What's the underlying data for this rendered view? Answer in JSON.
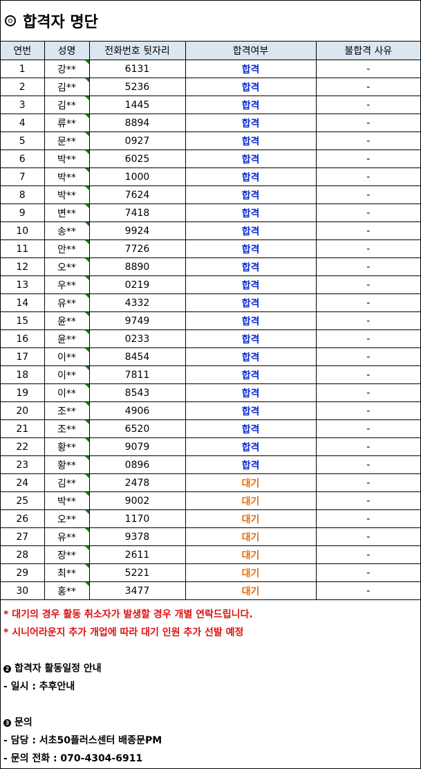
{
  "title": "합격자 명단",
  "columns": [
    "연번",
    "성명",
    "전화번호 뒷자리",
    "합격여부",
    "불합격 사유"
  ],
  "rows": [
    [
      "1",
      "강**",
      "6131",
      "합격",
      "-"
    ],
    [
      "2",
      "김**",
      "5236",
      "합격",
      "-"
    ],
    [
      "3",
      "김**",
      "1445",
      "합격",
      "-"
    ],
    [
      "4",
      "류**",
      "8894",
      "합격",
      "-"
    ],
    [
      "5",
      "문**",
      "0927",
      "합격",
      "-"
    ],
    [
      "6",
      "박**",
      "6025",
      "합격",
      "-"
    ],
    [
      "7",
      "박**",
      "1000",
      "합격",
      "-"
    ],
    [
      "8",
      "박**",
      "7624",
      "합격",
      "-"
    ],
    [
      "9",
      "변**",
      "7418",
      "합격",
      "-"
    ],
    [
      "10",
      "송**",
      "9924",
      "합격",
      "-"
    ],
    [
      "11",
      "안**",
      "7726",
      "합격",
      "-"
    ],
    [
      "12",
      "오**",
      "8890",
      "합격",
      "-"
    ],
    [
      "13",
      "우**",
      "0219",
      "합격",
      "-"
    ],
    [
      "14",
      "유**",
      "4332",
      "합격",
      "-"
    ],
    [
      "15",
      "윤**",
      "9749",
      "합격",
      "-"
    ],
    [
      "16",
      "윤**",
      "0233",
      "합격",
      "-"
    ],
    [
      "17",
      "이**",
      "8454",
      "합격",
      "-"
    ],
    [
      "18",
      "이**",
      "7811",
      "합격",
      "-"
    ],
    [
      "19",
      "이**",
      "8543",
      "합격",
      "-"
    ],
    [
      "20",
      "조**",
      "4906",
      "합격",
      "-"
    ],
    [
      "21",
      "조**",
      "6520",
      "합격",
      "-"
    ],
    [
      "22",
      "황**",
      "9079",
      "합격",
      "-"
    ],
    [
      "23",
      "황**",
      "0896",
      "합격",
      "-"
    ],
    [
      "24",
      "김**",
      "2478",
      "대기",
      "-"
    ],
    [
      "25",
      "박**",
      "9002",
      "대기",
      "-"
    ],
    [
      "26",
      "오**",
      "1170",
      "대기",
      "-"
    ],
    [
      "27",
      "유**",
      "9378",
      "대기",
      "-"
    ],
    [
      "28",
      "장**",
      "2611",
      "대기",
      "-"
    ],
    [
      "29",
      "최**",
      "5221",
      "대기",
      "-"
    ],
    [
      "30",
      "홍**",
      "3477",
      "대기",
      "-"
    ]
  ],
  "status_colors": {
    "합격": "#0a2bd1",
    "대기": "#e36c09"
  },
  "notes": {
    "red_1": "* 대기의 경우 활동 취소자가 발생할 경우 개별 연락드립니다.",
    "red_2": "* 시니어라운지 추가 개업에 따라 대기 인원 추가 선발 예정",
    "schedule_heading": "합격자 활동일정 안내",
    "schedule_line": "- 일시 : 추후안내",
    "contact_heading": "문의",
    "contact_person": "- 담당 : 서초50플러스센터 배종문PM",
    "contact_phone": "- 문의 전화 : 070-4304-6911"
  },
  "icons": {
    "title": "double-circle-icon",
    "section_2": "circled-2-icon",
    "section_3": "circled-3-icon"
  }
}
